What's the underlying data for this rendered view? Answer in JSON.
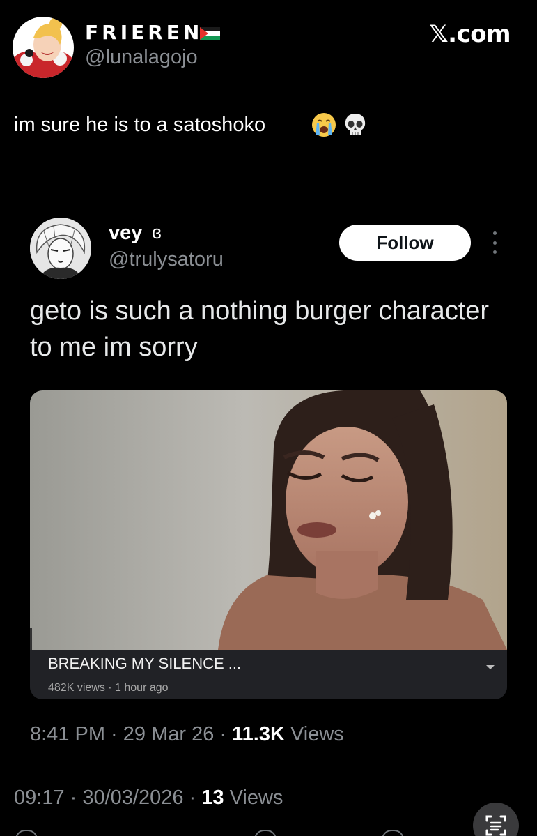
{
  "outer_tweet": {
    "author_name": "FRIEREN",
    "author_handle": "@lunalagojo",
    "text": "im sure he is to a satoshoko",
    "emojis": [
      "loudly-crying-face",
      "skull"
    ],
    "footer": {
      "time_date": "09:17 · 30/03/2026 · ",
      "views_count": "13",
      "views_label": " Views"
    }
  },
  "brand": {
    "watermark": "𝕏.com"
  },
  "quoted_tweet": {
    "author_name": "vey",
    "author_emoticon": "ɞ",
    "author_handle": "@trulysatoru",
    "follow_label": "Follow",
    "text": "geto is such a nothing burger character to me im sorry",
    "media": {
      "video_title": "BREAKING MY SILENCE ...",
      "video_meta": "482K views · 1 hour ago"
    },
    "footer": {
      "time_date": "8:41 PM · 29 Mar 26 · ",
      "views_count": "11.3K",
      "views_label": " Views"
    }
  },
  "icons": {
    "flag": "palestine-flag-icon",
    "more": "more-options-icon",
    "caret": "chevron-down-icon",
    "scan": "text-scan-icon"
  },
  "colors": {
    "background": "#000000",
    "secondary_text": "#8b8f94",
    "primary_text": "#ffffff",
    "divider": "#2f3336",
    "follow_button_bg": "#ffffff"
  }
}
